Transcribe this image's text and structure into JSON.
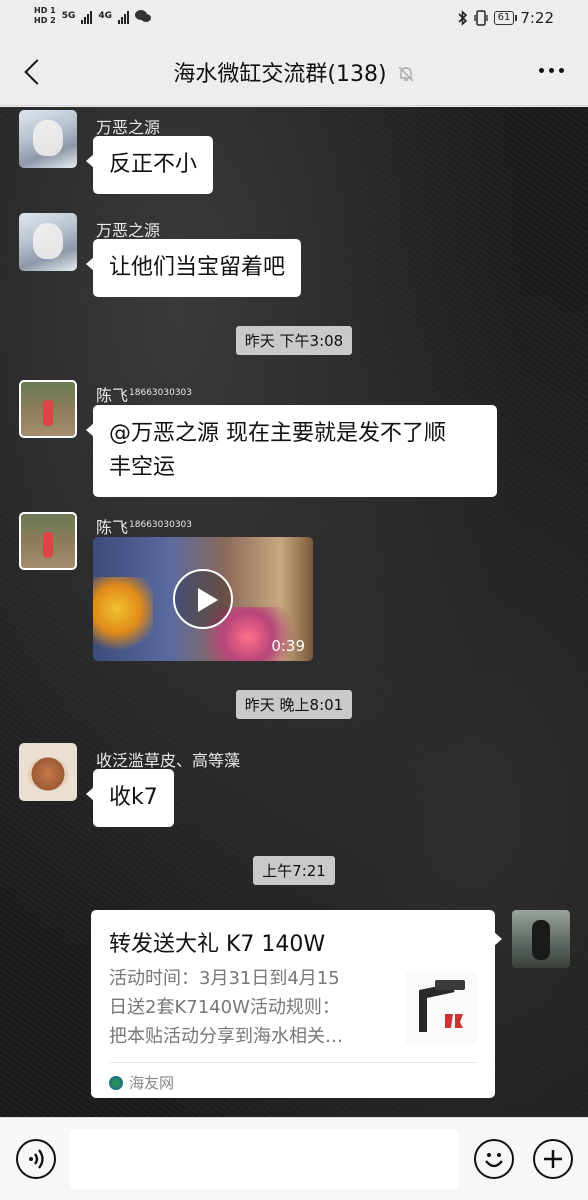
{
  "status_bar": {
    "left": {
      "hd1": "HD 1",
      "hd2": "HD 2",
      "net1": "5G",
      "net2": "4G"
    },
    "battery": "61",
    "time": "7:22"
  },
  "header": {
    "title": "海水微缸交流群(138)"
  },
  "messages": [
    {
      "sender": "万恶之源",
      "text": "反正不小"
    },
    {
      "sender": "万恶之源",
      "text": "让他们当宝留着吧"
    },
    {
      "timestamp": "昨天 下午3:08"
    },
    {
      "sender": "陈飞",
      "sender_sup": "18663030303",
      "text_line1": "@万恶之源  现在主要就是发不了顺",
      "text_line2": "丰空运"
    },
    {
      "sender": "陈飞",
      "sender_sup": "18663030303",
      "video_duration": "0:39"
    },
    {
      "timestamp": "昨天 晚上8:01"
    },
    {
      "sender": "收泛滥草皮、高等藻",
      "text": "收k7"
    },
    {
      "timestamp": "上午7:21"
    }
  ],
  "link_card": {
    "title": "转发送大礼 K7 140W",
    "desc_line1": "活动时间：3月31日到4月15",
    "desc_line2": "日送2套K7140W活动规则：",
    "desc_line3": "把本贴活动分享到海水相关…",
    "source": "海友网"
  },
  "colors": {
    "bubble": "#ffffff",
    "chat_bg": "#1c1c1c",
    "header_bg": "#ededed",
    "timestamp_bg": "#c9c9c9"
  }
}
